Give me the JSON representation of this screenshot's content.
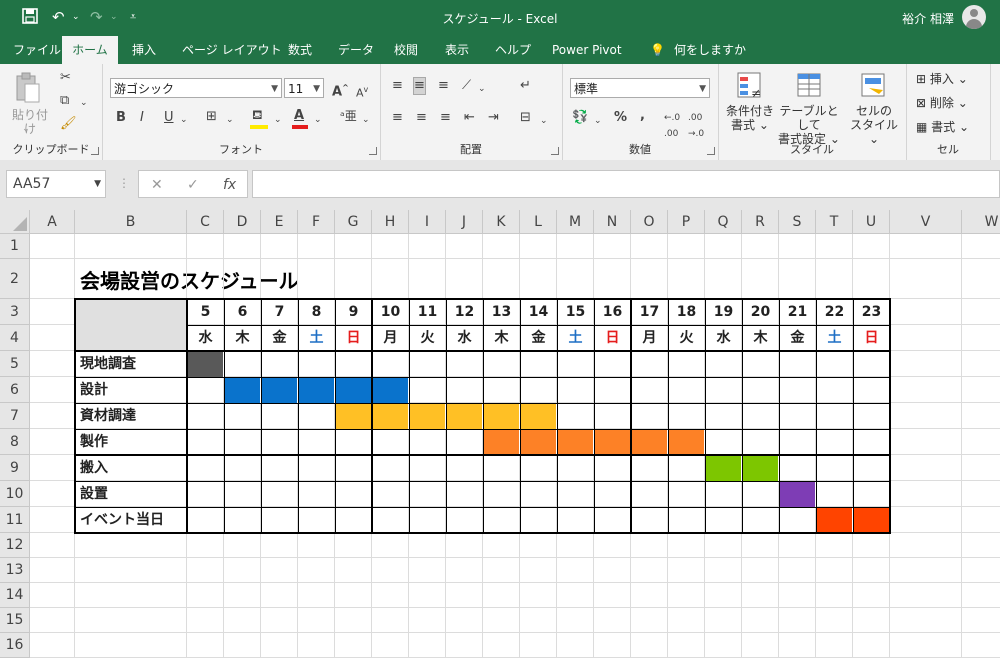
{
  "window": {
    "title": "スケジュール  -  Excel",
    "user_name": "裕介 相澤"
  },
  "qat": {
    "save_icon": "save-icon",
    "undo_icon": "undo-icon",
    "redo_icon": "redo-icon",
    "customize_icon": "customize-icon"
  },
  "tabs": [
    "ファイル",
    "ホーム",
    "挿入",
    "ページ レイアウト",
    "数式",
    "データ",
    "校閲",
    "表示",
    "ヘルプ",
    "Power Pivot",
    "何をしますか"
  ],
  "active_tab": "ホーム",
  "ribbon": {
    "clipboard": {
      "label": "クリップボード",
      "paste": "貼り付け"
    },
    "font": {
      "label": "フォント",
      "name": "游ゴシック",
      "size": "11",
      "bold": "B",
      "italic": "I",
      "underline": "U"
    },
    "alignment": {
      "label": "配置"
    },
    "number": {
      "label": "数値",
      "format": "標準",
      "percent": "%",
      "comma": ","
    },
    "styles": {
      "label": "スタイル",
      "conditional": [
        "条件付き",
        "書式"
      ],
      "table": [
        "テーブルとして",
        "書式設定"
      ],
      "cell": [
        "セルの",
        "スタイル"
      ]
    },
    "cells": {
      "label": "セル",
      "insert": "挿入",
      "delete": "削除",
      "format": "書式"
    }
  },
  "formula_bar": {
    "name_box": "AA57",
    "cancel": "✕",
    "enter": "✓",
    "fx": "fx",
    "value": ""
  },
  "columns": [
    "A",
    "B",
    "C",
    "D",
    "E",
    "F",
    "G",
    "H",
    "I",
    "J",
    "K",
    "L",
    "M",
    "N",
    "O",
    "P",
    "Q",
    "R",
    "S",
    "T",
    "U",
    "V",
    "W"
  ],
  "rows": [
    "1",
    "2",
    "3",
    "4",
    "5",
    "6",
    "7",
    "8",
    "9",
    "10",
    "11",
    "12",
    "13",
    "14",
    "15",
    "16"
  ],
  "sheet": {
    "title": "会場設営のスケジュール",
    "days": [
      "5",
      "6",
      "7",
      "8",
      "9",
      "10",
      "11",
      "12",
      "13",
      "14",
      "15",
      "16",
      "17",
      "18",
      "19",
      "20",
      "21",
      "22",
      "23"
    ],
    "weekdays": [
      "水",
      "木",
      "金",
      "土",
      "日",
      "月",
      "火",
      "水",
      "木",
      "金",
      "土",
      "日",
      "月",
      "火",
      "水",
      "木",
      "金",
      "土",
      "日"
    ],
    "saturday_color": "#1f6fc5",
    "sunday_color": "#e51d1d",
    "tasks": [
      {
        "name": "現地調査",
        "start": 0,
        "length": 1,
        "color": "#595959"
      },
      {
        "name": "設計",
        "start": 1,
        "length": 5,
        "color": "#0a73cc"
      },
      {
        "name": "資材調達",
        "start": 4,
        "length": 6,
        "color": "#ffc025"
      },
      {
        "name": "製作",
        "start": 8,
        "length": 6,
        "color": "#fd8126"
      },
      {
        "name": "搬入",
        "start": 14,
        "length": 2,
        "color": "#7dc600"
      },
      {
        "name": "設置",
        "start": 16,
        "length": 1,
        "color": "#7e3db5"
      },
      {
        "name": "イベント当日",
        "start": 17,
        "length": 2,
        "color": "#ff4400"
      }
    ]
  }
}
